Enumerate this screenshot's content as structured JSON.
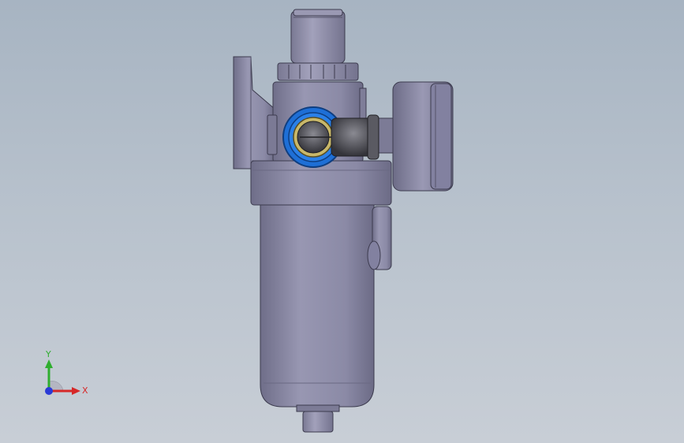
{
  "viewport": {
    "background_top": "#a7b4c2",
    "background_bottom": "#c8ced6",
    "part_color": "#8e8da8",
    "fitting_ring_color": "#1e6fd6",
    "fitting_body_color": "#4a4a52"
  },
  "triad": {
    "y_label": "Y",
    "x_label": "X",
    "y_color": "#2fae2f",
    "x_color": "#d62828",
    "z_color": "#2a3ad6"
  }
}
